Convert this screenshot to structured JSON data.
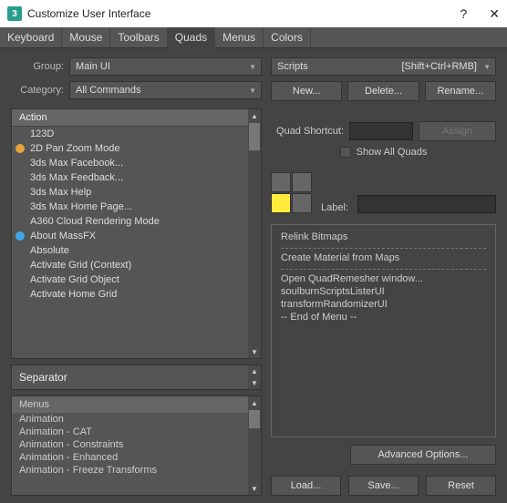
{
  "window": {
    "title": "Customize User Interface"
  },
  "tabs": [
    "Keyboard",
    "Mouse",
    "Toolbars",
    "Quads",
    "Menus",
    "Colors"
  ],
  "active_tab": 3,
  "left": {
    "group_label": "Group:",
    "group_value": "Main UI",
    "category_label": "Category:",
    "category_value": "All Commands",
    "action_header": "Action",
    "actions": [
      {
        "label": "123D"
      },
      {
        "label": "2D Pan Zoom Mode",
        "icon": "lock"
      },
      {
        "label": "3ds Max Facebook..."
      },
      {
        "label": "3ds Max Feedback..."
      },
      {
        "label": "3ds Max Help"
      },
      {
        "label": "3ds Max Home Page..."
      },
      {
        "label": "A360 Cloud Rendering Mode"
      },
      {
        "label": "About MassFX",
        "icon": "info"
      },
      {
        "label": "Absolute"
      },
      {
        "label": "Activate Grid (Context)"
      },
      {
        "label": "Activate Grid Object"
      },
      {
        "label": "Activate Home Grid"
      }
    ],
    "separator_label": "Separator",
    "menus_header": "Menus",
    "menus": [
      "Animation",
      "Animation - CAT",
      "Animation - Constraints",
      "Animation - Enhanced",
      "Animation - Freeze Transforms"
    ]
  },
  "right": {
    "quad_set_label": "Scripts",
    "quad_shortcut_value": "[Shift+Ctrl+RMB]",
    "btn_new": "New...",
    "btn_delete": "Delete...",
    "btn_rename": "Rename...",
    "shortcut_label": "Quad Shortcut:",
    "shortcut_value": "",
    "assign_label": "Assign",
    "show_all_label": "Show All Quads",
    "label_label": "Label:",
    "label_value": "",
    "menu_items": [
      "Relink Bitmaps",
      "---",
      "Create Material from Maps",
      "---",
      "Open QuadRemesher window...",
      "soulburnScriptsListerUI",
      "transformRandomizerUI",
      "-- End of Menu --"
    ],
    "advanced": "Advanced Options...",
    "load": "Load...",
    "save": "Save...",
    "reset": "Reset"
  }
}
